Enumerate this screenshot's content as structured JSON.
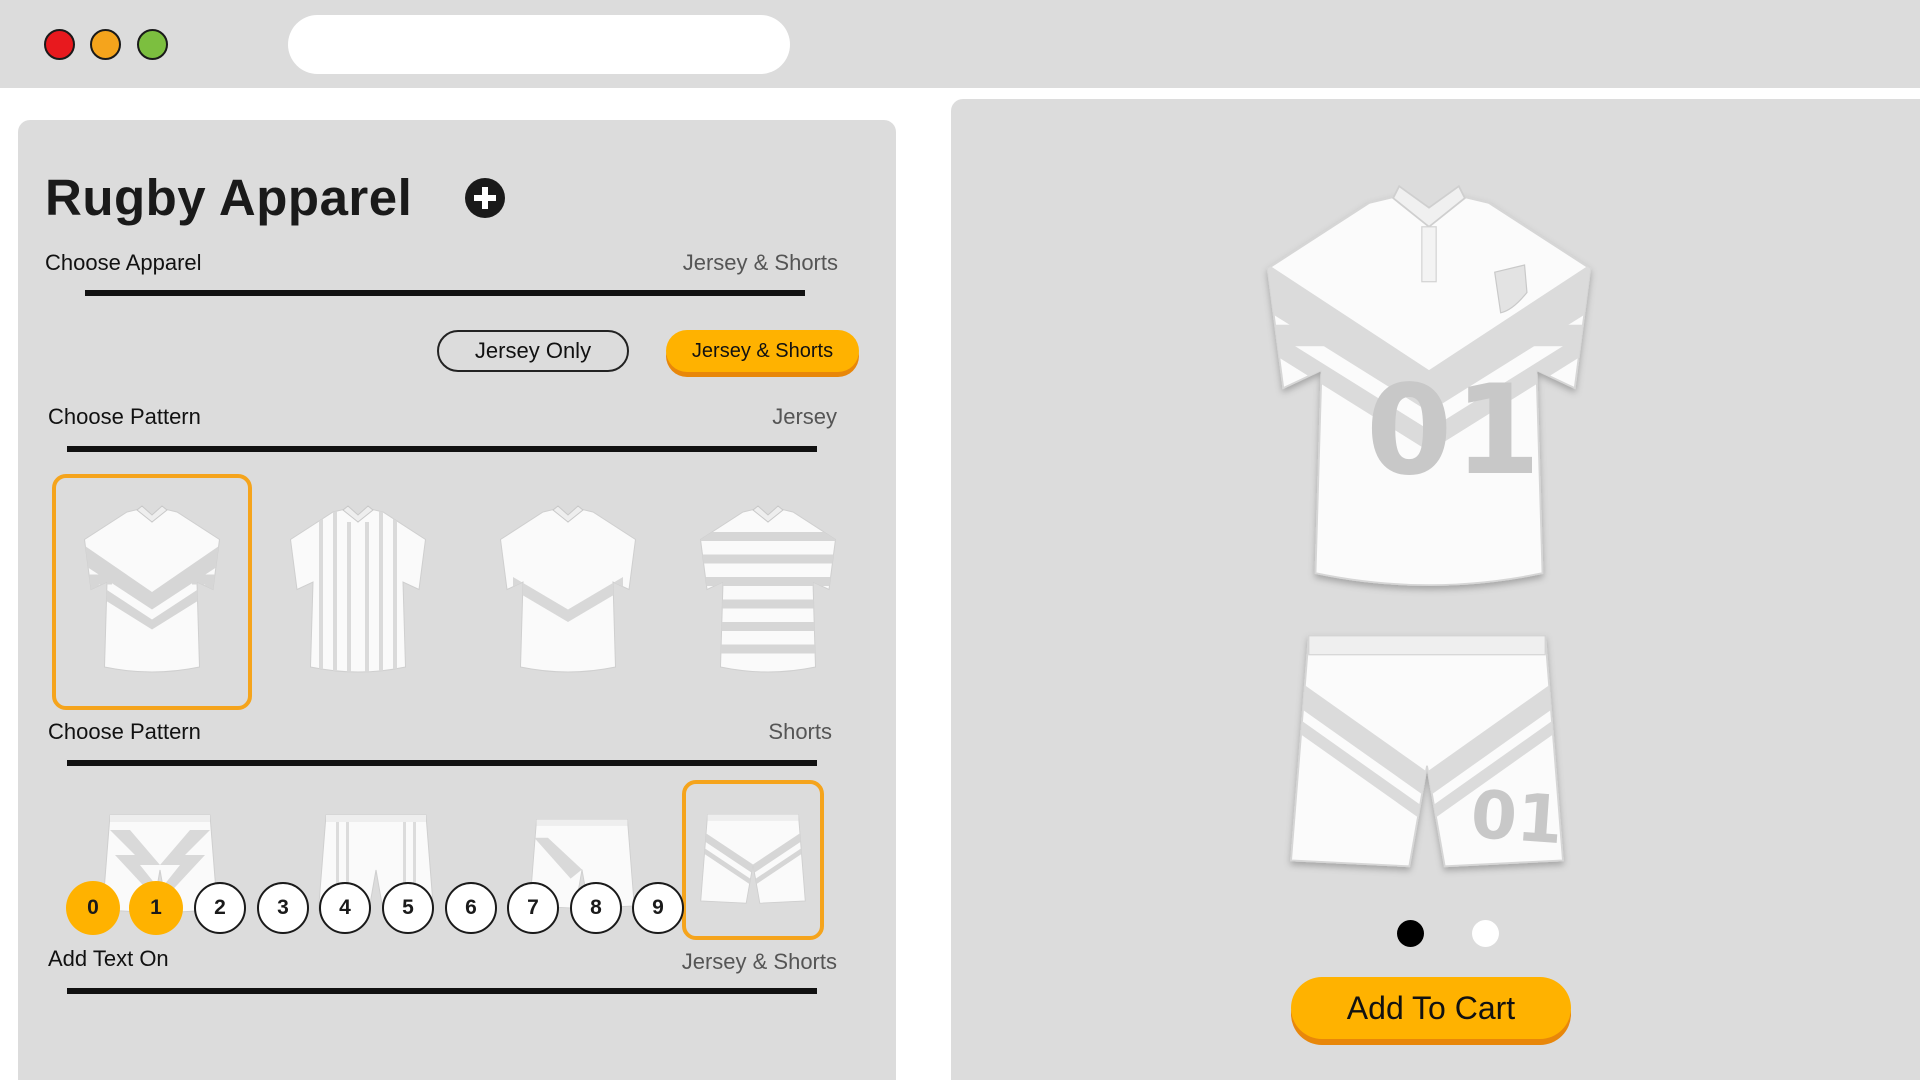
{
  "window": {
    "controls": [
      "close-icon",
      "minimize-icon",
      "maximize-icon"
    ],
    "address_bar": ""
  },
  "left_panel": {
    "title": "Rugby Apparel",
    "add_icon": "plus-circle-icon",
    "choose_apparel": {
      "label": "Choose Apparel",
      "value": "Jersey & Shorts"
    },
    "apparel_options": [
      {
        "label": "Jersey Only",
        "selected": false
      },
      {
        "label": "Jersey & Shorts",
        "selected": true
      }
    ],
    "jersey_pattern": {
      "label": "Choose Pattern",
      "value": "Jersey",
      "options": [
        "chevron",
        "vertical-stripes",
        "sash-fern",
        "horizontal-hoops"
      ],
      "selected_index": 0
    },
    "shorts_pattern": {
      "label": "Choose Pattern",
      "value": "Shorts",
      "options": [
        "lightning",
        "vertical-stripes",
        "sash-fern",
        "chevron"
      ],
      "selected_index": 3
    },
    "add_text": {
      "label": "Add Text On",
      "value": "Jersey & Shorts",
      "digits": [
        "0",
        "1",
        "2",
        "3",
        "4",
        "5",
        "6",
        "7",
        "8",
        "9"
      ],
      "selected_digits": [
        "0",
        "1"
      ]
    }
  },
  "preview": {
    "jersey_number": "01",
    "shorts_number": "01",
    "pagination": {
      "count": 2,
      "active_index": 0
    },
    "add_to_cart": "Add To Cart"
  },
  "colors": {
    "accent": "#ffb200",
    "accent_shadow": "#e8870a",
    "selection_border": "#f5a41c",
    "panel_bg": "#dcdcdc",
    "pattern_grey": "#d9d9d9",
    "number_grey": "#c8c8c8"
  }
}
